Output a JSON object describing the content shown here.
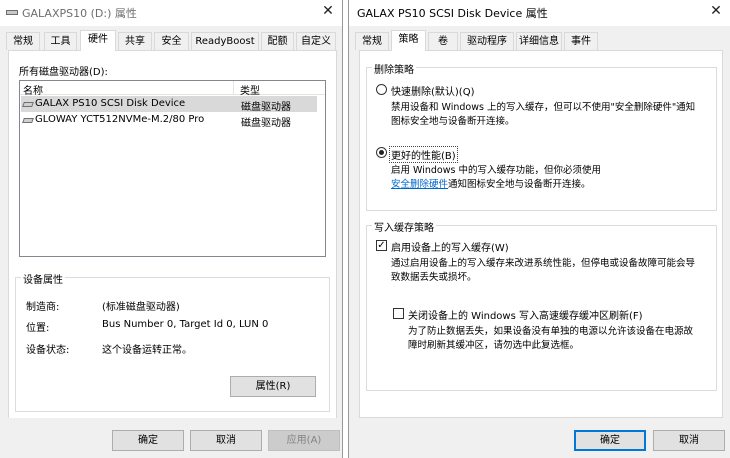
{
  "left_window": {
    "title": "GALAXPS10 (D:) 属性",
    "close_glyph": "✕",
    "tabs": [
      "常规",
      "工具",
      "硬件",
      "共享",
      "安全",
      "ReadyBoost",
      "配额",
      "自定义"
    ],
    "active_tab": "硬件",
    "disks_label": "所有磁盘驱动器(D):",
    "columns": {
      "name": "名称",
      "type": "类型"
    },
    "disks": [
      {
        "name": "GALAX PS10 SCSI Disk Device",
        "type": "磁盘驱动器",
        "selected": true
      },
      {
        "name": "GLOWAY YCT512NVMe-M.2/80 Pro",
        "type": "磁盘驱动器",
        "selected": false
      }
    ],
    "properties": {
      "group_title": "设备属性",
      "manufacturer_label": "制造商:",
      "manufacturer_value": "(标准磁盘驱动器)",
      "location_label": "位置:",
      "location_value": "Bus Number 0, Target Id 0, LUN 0",
      "status_label": "设备状态:",
      "status_value": "这个设备运转正常。",
      "properties_button": "属性(R)"
    },
    "buttons": {
      "ok": "确定",
      "cancel": "取消",
      "apply": "应用(A)"
    }
  },
  "right_window": {
    "title": "GALAX PS10 SCSI Disk Device 属性",
    "close_glyph": "✕",
    "tabs": [
      "常规",
      "策略",
      "卷",
      "驱动程序",
      "详细信息",
      "事件"
    ],
    "active_tab": "策略",
    "removal_policy": {
      "group_title": "删除策略",
      "quick_removal_label": "快速删除(默认)(Q)",
      "quick_removal_selected": false,
      "quick_removal_desc_1": "禁用设备和 Windows 上的写入缓存，但可以不使用\"安全删除硬件\"通知",
      "quick_removal_desc_2": "图标安全地与设备断开连接。",
      "better_perf_label": "更好的性能(B)",
      "better_perf_selected": true,
      "better_perf_desc_1": "启用 Windows 中的写入缓存功能，但你必须使用",
      "better_perf_link": "安全删除硬件",
      "better_perf_desc_2": "通知图标安全地与设备断开连接。"
    },
    "write_cache_policy": {
      "group_title": "写入缓存策略",
      "enable_cache_label": "启用设备上的写入缓存(W)",
      "enable_cache_checked": true,
      "enable_cache_desc_1": "通过启用设备上的写入缓存来改进系统性能，但停电或设备故障可能会导",
      "enable_cache_desc_2": "致数据丢失或损坏。",
      "flush_off_label": "关闭设备上的 Windows 写入高速缓存缓冲区刷新(F)",
      "flush_off_checked": false,
      "flush_off_desc_1": "为了防止数据丢失，如果设备没有单独的电源以允许该设备在电源故",
      "flush_off_desc_2": "障时刷新其缓冲区，请勿选中此复选框。"
    },
    "buttons": {
      "ok": "确定",
      "cancel": "取消"
    }
  },
  "icons": {
    "radio_checked": "●",
    "checkbox_checked": "✓"
  }
}
